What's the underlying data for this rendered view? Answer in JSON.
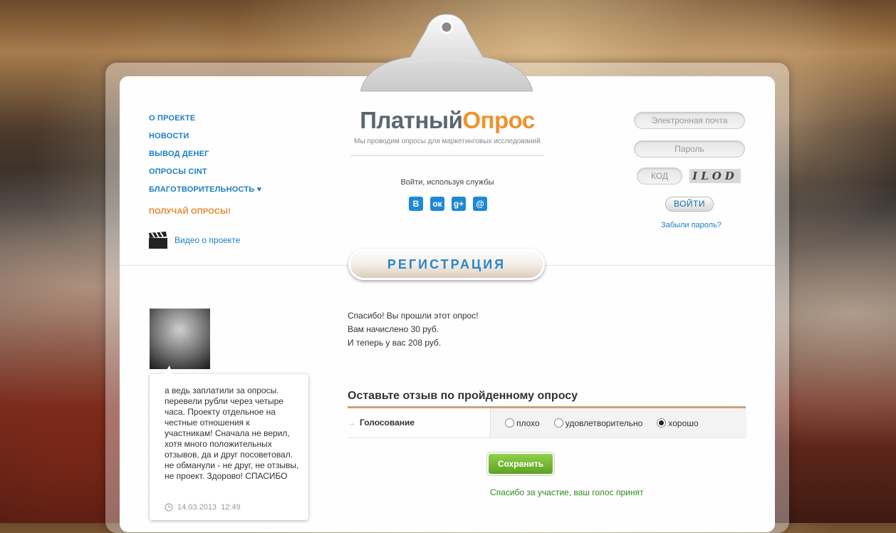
{
  "nav": {
    "about": "О ПРОЕКТЕ",
    "news": "НОВОСТИ",
    "withdraw": "ВЫВОД ДЕНЕГ",
    "cint": "ОПРОСЫ CINT",
    "charity": "БЛАГОТВОРИТЕЛЬНОСТЬ ♥",
    "get_polls": "ПОЛУЧАЙ ОПРОСЫ!",
    "video": "Видео о проекте"
  },
  "logo": {
    "part1": "Платный",
    "part2": "Опрос",
    "tagline": "Мы проводим опросы для маркетинговых исследований"
  },
  "social": {
    "label": "Войти, используя службы",
    "icons": [
      "vk-icon",
      "odnoklassniki-icon",
      "google-plus-icon",
      "mail-icon"
    ]
  },
  "login": {
    "email_placeholder": "Электронная почта",
    "password_placeholder": "Пароль",
    "code_placeholder": "КОД",
    "captcha_text": "ILOD",
    "login_button": "ВОЙТИ",
    "forgot": "Забыли пароль?"
  },
  "register_button": "РЕГИСТРАЦИЯ",
  "testimonial": {
    "text": "а ведь заплатили за опросы. перевели рубли через четыре часа. Проекту отдельное на честные отношения к участникам! Сначала не верил, хотя много положительных отзывов, да и друг посоветовал. не обманули - не друг, не отзывы, не проект. Здорово! СПАСИБО",
    "date": "14.03.2013",
    "time": "12:49"
  },
  "result": {
    "line1": "Спасибо! Вы прошли этот опрос!",
    "line2": "Вам начислено 30 руб.",
    "line3": "И теперь у вас 208 руб."
  },
  "feedback": {
    "title": "Оставьте отзыв по пройденному опросу",
    "row_label": "Голосование",
    "options": [
      "плохо",
      "удовлетворительно",
      "хорошо"
    ],
    "selected": "хорошо",
    "save_button": "Сохранить",
    "thanks": "Спасибо за участие, ваш голос принят"
  },
  "colors": {
    "link_blue": "#1a7fc4",
    "orange": "#f0922e",
    "green_button": "#6fb52e",
    "success_green": "#2d8a1f"
  }
}
